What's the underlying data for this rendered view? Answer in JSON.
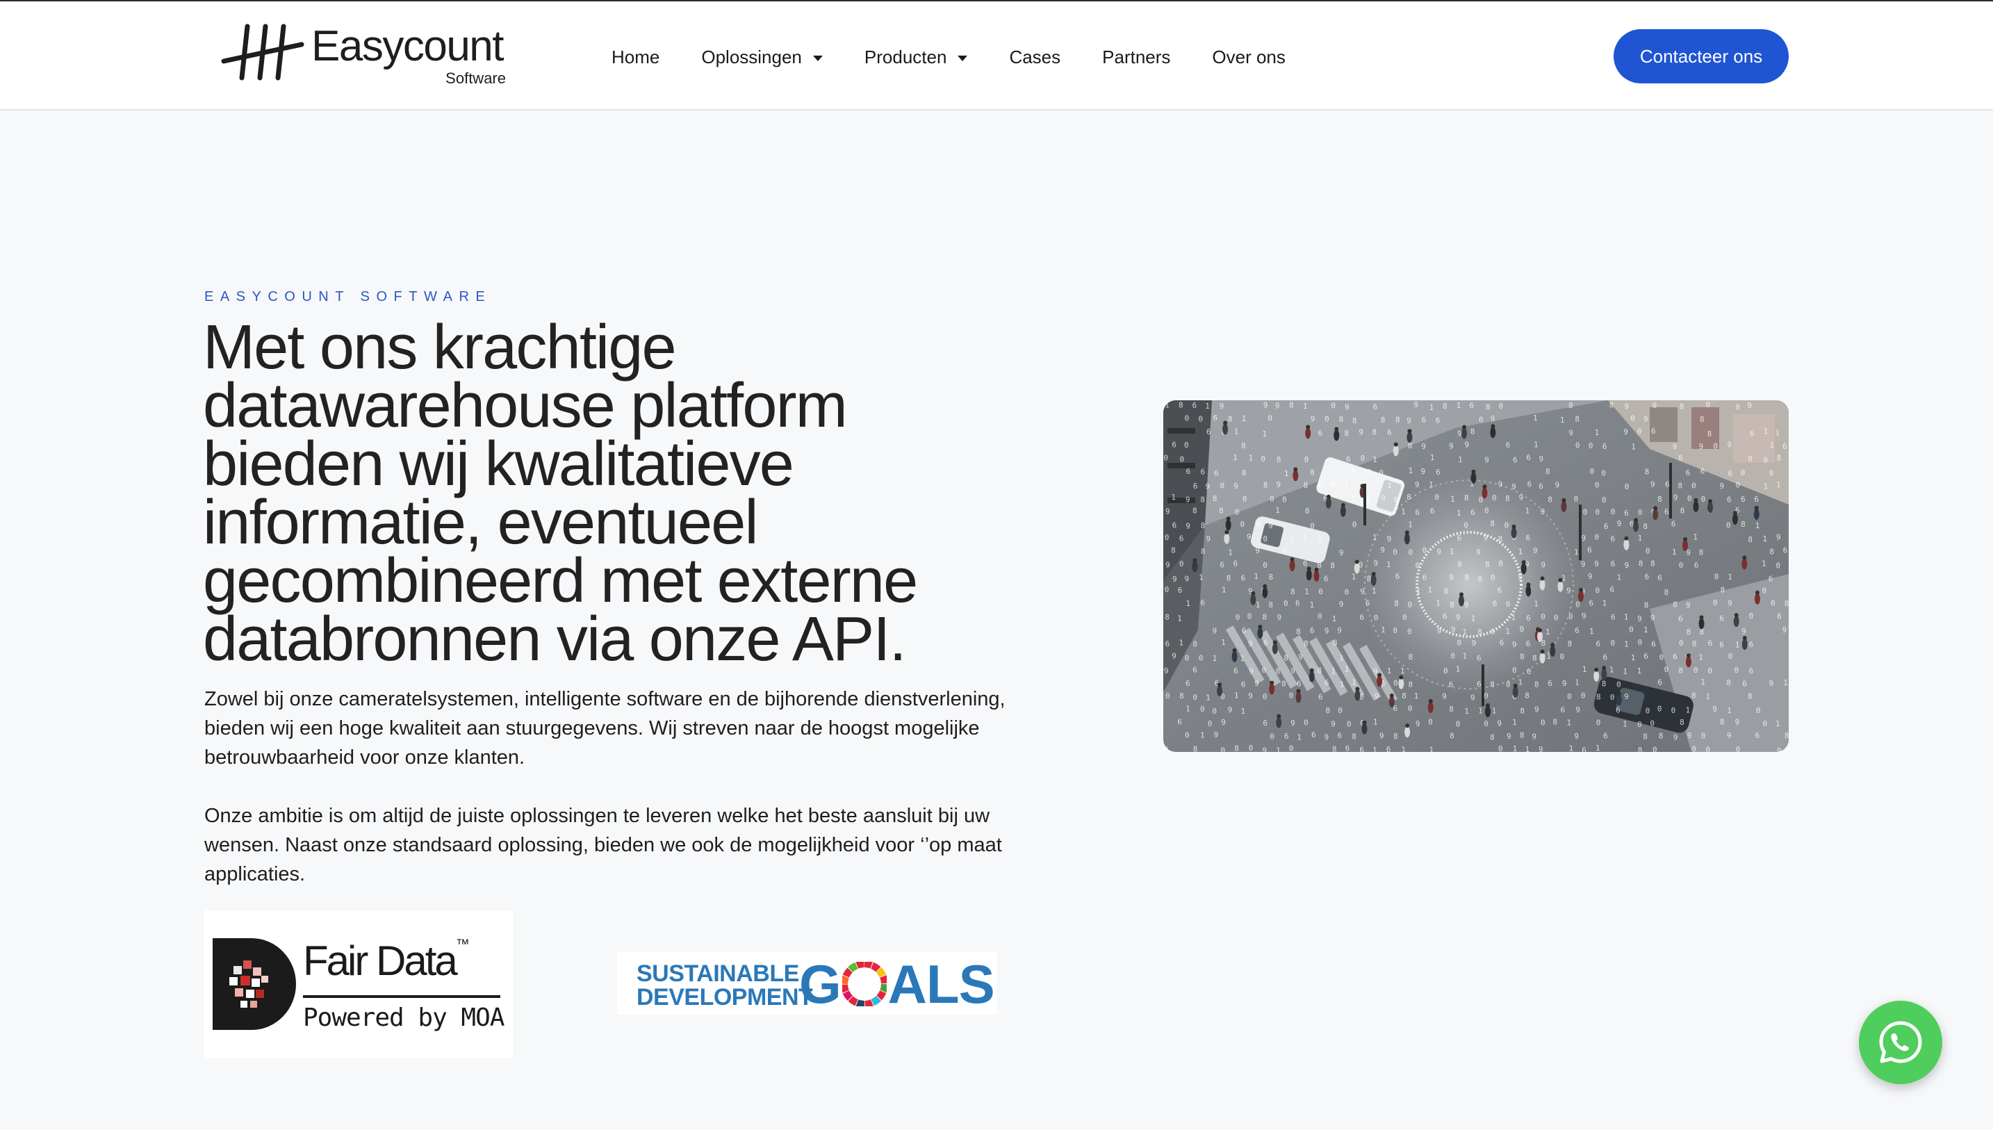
{
  "brand": {
    "name": "Easycount",
    "sub": "Software"
  },
  "nav": {
    "items": [
      {
        "label": "Home",
        "dropdown": false
      },
      {
        "label": "Oplossingen",
        "dropdown": true
      },
      {
        "label": "Producten",
        "dropdown": true
      },
      {
        "label": "Cases",
        "dropdown": false
      },
      {
        "label": "Partners",
        "dropdown": false
      },
      {
        "label": "Over ons",
        "dropdown": false
      }
    ],
    "cta_label": "Contacteer ons"
  },
  "hero": {
    "eyebrow": "EASYCOUNT SOFTWARE",
    "headline": "Met ons krachtige datawarehouse platform bieden wij kwalitatieve informatie, eventueel gecombineerd met externe databronnen via onze API.",
    "paragraph_1": "Zowel bij onze cameratelsystemen, intelligente software en de bijhorende dienstverlening, bieden wij een hoge kwaliteit aan stuurgegevens. Wij streven naar de hoogst mogelijke betrouwbaarheid voor onze klanten.",
    "paragraph_2": "Onze ambitie is om altijd de juiste oplossingen te leveren welke het beste aansluit bij uw wensen. Naast onze standsaard oplossing, bieden we ook de mogelijkheid voor ‘’op maat applicaties."
  },
  "partners": {
    "fairdata_title": "Fair Data",
    "fairdata_tm": "™",
    "fairdata_sub": "Powered by MOA",
    "sdg_line_1": "SUSTAINABLE",
    "sdg_line_2": "DEVELOPMENT",
    "sdg_g": "G",
    "sdg_rest": "ALS"
  },
  "icons": {
    "dropdown": "chevron-down-icon",
    "whatsapp": "whatsapp-icon"
  },
  "colors": {
    "accent": "#1f55d3",
    "eyebrow": "#2a56c6",
    "sdg_blue": "#2a78b8",
    "whatsapp": "#4fce5d"
  }
}
